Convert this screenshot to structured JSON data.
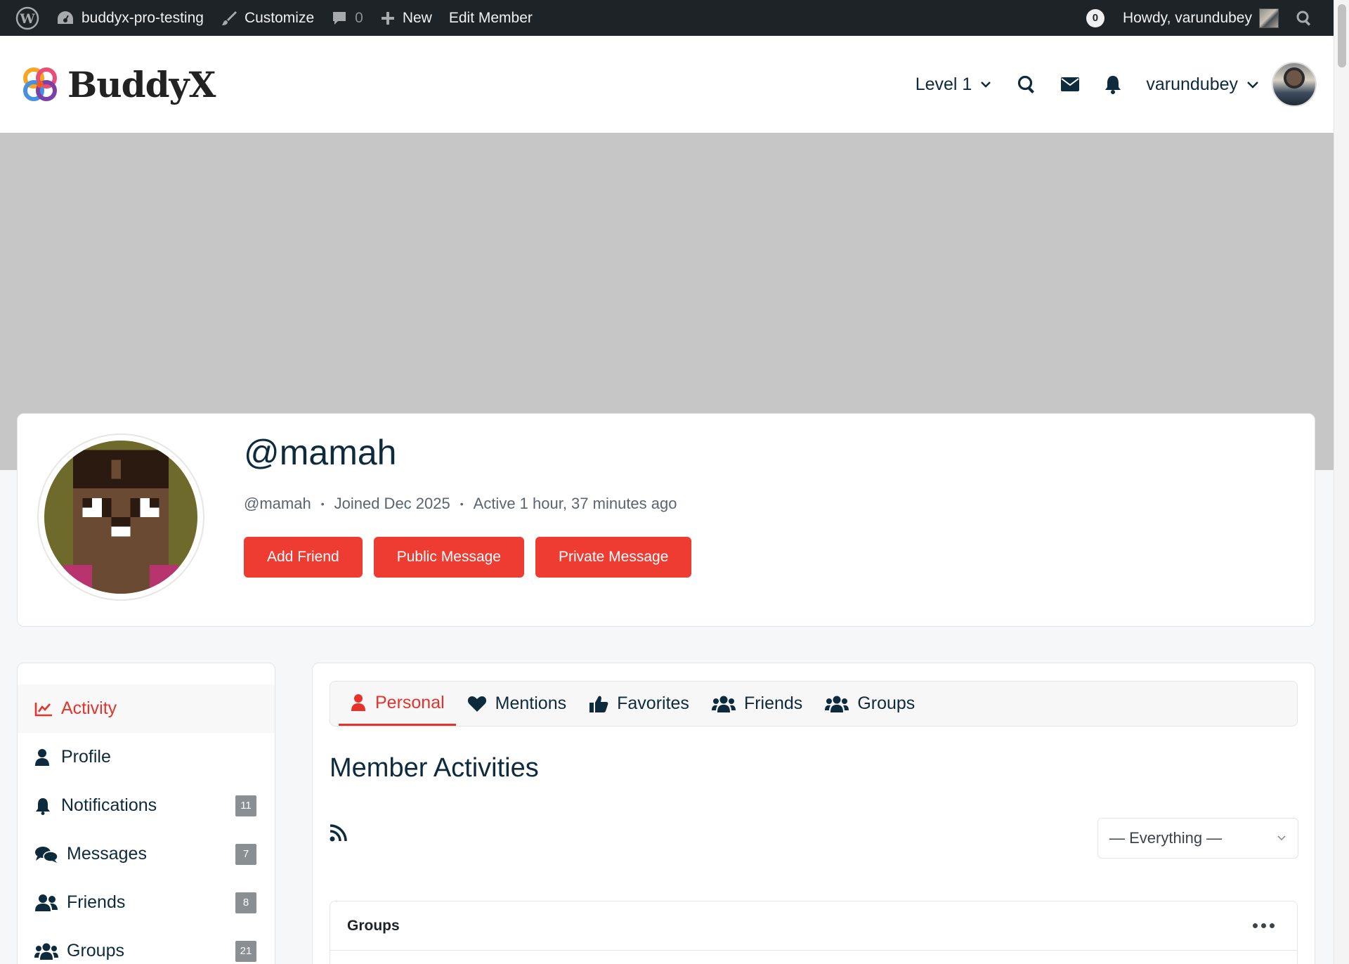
{
  "admin_bar": {
    "site_name": "buddyx-pro-testing",
    "customize": "Customize",
    "comments_count": "0",
    "new": "New",
    "edit_member": "Edit Member",
    "notifications_badge": "0",
    "howdy": "Howdy, varundubey"
  },
  "header": {
    "logo_text": "BuddyX",
    "level": "Level 1",
    "username": "varundubey"
  },
  "profile": {
    "display_name": "@mamah",
    "handle": "@mamah",
    "joined": "Joined Dec 2025",
    "active": "Active 1 hour, 37 minutes ago",
    "actions": {
      "add_friend": "Add Friend",
      "public_message": "Public Message",
      "private_message": "Private Message"
    }
  },
  "sidebar": {
    "items": [
      {
        "label": "Activity",
        "icon": "activity-chart-icon",
        "active": true
      },
      {
        "label": "Profile",
        "icon": "user-icon"
      },
      {
        "label": "Notifications",
        "icon": "bell-icon",
        "count": "11"
      },
      {
        "label": "Messages",
        "icon": "comments-icon",
        "count": "7"
      },
      {
        "label": "Friends",
        "icon": "user-friends-icon",
        "count": "8"
      },
      {
        "label": "Groups",
        "icon": "users-icon",
        "count": "21"
      }
    ]
  },
  "main": {
    "tabs": [
      {
        "label": "Personal",
        "icon": "user-icon",
        "active": true
      },
      {
        "label": "Mentions",
        "icon": "heart-icon"
      },
      {
        "label": "Favorites",
        "icon": "thumbs-up-icon"
      },
      {
        "label": "Friends",
        "icon": "user-friends-icon"
      },
      {
        "label": "Groups",
        "icon": "users-icon"
      }
    ],
    "section_title": "Member Activities",
    "filter_value": "— Everything —",
    "groups_card_title": "Groups"
  },
  "colors": {
    "accent": "#ee3c32",
    "active_text": "#e4332b",
    "admin_bar": "#1e2327",
    "cover": "#c6c6c6",
    "heading": "#0e2a3d"
  }
}
